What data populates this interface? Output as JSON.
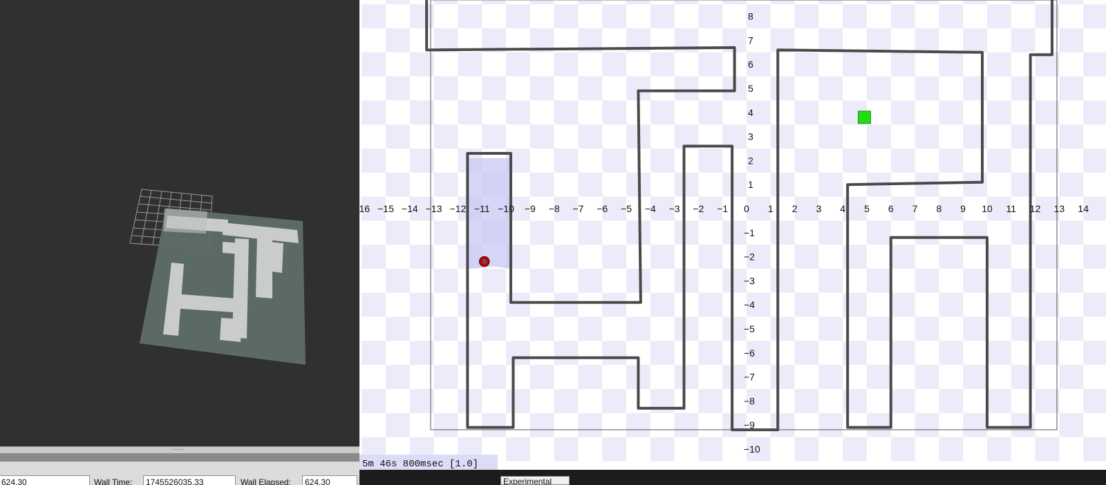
{
  "rviz": {
    "time_bar": {
      "ros_time_value": "624.30",
      "wall_time_label": "Wall Time:",
      "wall_time_value": "1745526035.33",
      "wall_elapsed_label": "Wall Elapsed:",
      "wall_elapsed_value": "624.30"
    },
    "viewport": {
      "background": "#303030",
      "map_color": "#5e6e6a",
      "free_space_color": "#d8d8d8"
    }
  },
  "stage": {
    "sim_time": "5m 46s 800msec [1.0]",
    "x_axis_labels": [
      "-16",
      "-15",
      "-14",
      "-13",
      "-12",
      "-11",
      "-10",
      "-9",
      "-8",
      "-7",
      "-6",
      "-5",
      "-4",
      "-3",
      "-2",
      "-1",
      "0",
      "1",
      "2",
      "3",
      "4",
      "5",
      "6",
      "7",
      "8",
      "9",
      "10",
      "11",
      "12",
      "13",
      "14"
    ],
    "y_axis_labels": [
      "8",
      "7",
      "6",
      "5",
      "4",
      "3",
      "2",
      "1",
      "0",
      "-1",
      "-2",
      "-3",
      "-4",
      "-5",
      "-6",
      "-7",
      "-8",
      "-9",
      "-10"
    ],
    "robot": {
      "x": -10.9,
      "y": -2.2,
      "color": "#cc0000"
    },
    "goal": {
      "x": 4.9,
      "y": 3.8,
      "color": "#22dd11"
    },
    "wall_color": "#4a4a4a",
    "checker_color": "#ecebfa",
    "walls": [
      [
        [
          -13.3,
          8.7
        ],
        [
          -13.3,
          6.6
        ],
        [
          -0.5,
          6.7
        ],
        [
          -0.5,
          4.9
        ],
        [
          -4.5,
          4.9
        ],
        [
          -4.4,
          -3.9
        ],
        [
          -9.8,
          -3.9
        ],
        [
          -9.8,
          2.3
        ],
        [
          -11.6,
          2.3
        ],
        [
          -11.6,
          -9.1
        ],
        [
          -9.7,
          -9.1
        ],
        [
          -9.7,
          -6.2
        ],
        [
          -4.5,
          -6.2
        ],
        [
          -4.5,
          -8.3
        ],
        [
          -2.6,
          -8.3
        ],
        [
          -2.6,
          2.6
        ],
        [
          -0.6,
          2.6
        ],
        [
          -0.6,
          -9.2
        ],
        [
          1.3,
          -9.2
        ],
        [
          1.3,
          6.6
        ],
        [
          9.8,
          6.5
        ],
        [
          9.8,
          1.1
        ],
        [
          4.2,
          1.0
        ],
        [
          4.2,
          -9.1
        ],
        [
          6.0,
          -9.1
        ],
        [
          6.0,
          -1.2
        ],
        [
          10.0,
          -1.2
        ],
        [
          10.0,
          -9.1
        ],
        [
          11.8,
          -9.1
        ],
        [
          11.8,
          6.4
        ],
        [
          12.7,
          6.4
        ],
        [
          12.7,
          8.7
        ]
      ]
    ],
    "toolbar_button": "Experimental"
  }
}
